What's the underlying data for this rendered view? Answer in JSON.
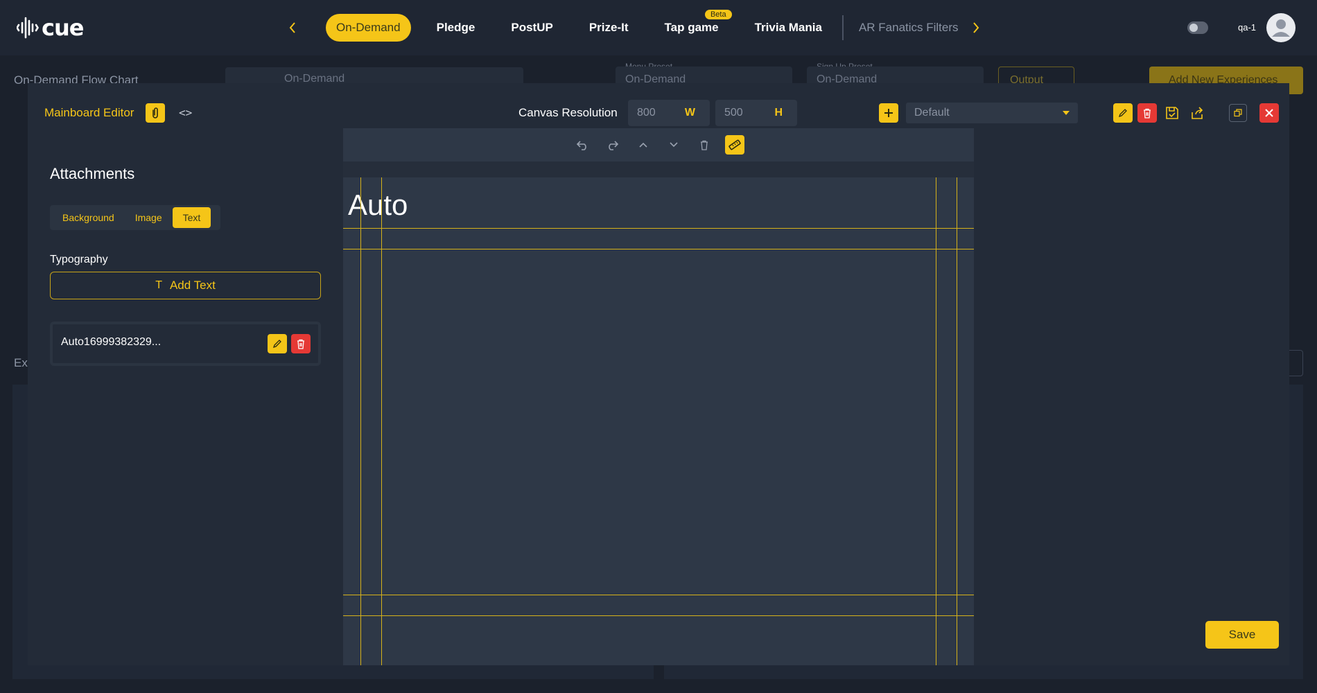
{
  "app": {
    "logo_text": "cue"
  },
  "nav": {
    "tabs": [
      {
        "label": "On-Demand",
        "state": "active"
      },
      {
        "label": "Pledge"
      },
      {
        "label": "PostUP"
      },
      {
        "label": "Prize-It"
      },
      {
        "label": "Tap game",
        "badge": "Beta"
      },
      {
        "label": "Trivia Mania"
      },
      {
        "label": "AR Fanatics Filters",
        "state": "dim"
      }
    ]
  },
  "user": {
    "name": "qa-1"
  },
  "background_page": {
    "title": "On-Demand Flow Chart",
    "flow_select_value": "On-Demand",
    "menu_preset_label": "Menu Preset",
    "menu_preset_value": "On-Demand",
    "signup_preset_label": "Sign Up Preset",
    "signup_preset_value": "On-Demand",
    "output_label": "Output",
    "add_experience_label": "Add New Experiences",
    "section_label": "Exp"
  },
  "modal": {
    "title": "Mainboard Editor",
    "canvas_resolution_label": "Canvas Resolution",
    "width_value": "800",
    "width_unit": "W",
    "height_value": "500",
    "height_unit": "H",
    "preset_value": "Default",
    "attachments_title": "Attachments",
    "attachment_tabs": [
      {
        "label": "Background"
      },
      {
        "label": "Image"
      },
      {
        "label": "Text",
        "state": "active"
      }
    ],
    "typography_label": "Typography",
    "add_text_label": "Add Text",
    "attachment_items": [
      {
        "name": "Auto16999382329..."
      }
    ],
    "canvas_text": "Auto",
    "save_label": "Save"
  },
  "colors": {
    "accent": "#f5c518",
    "danger": "#e53935",
    "background": "#1b212c",
    "panel": "#232b38",
    "canvas": "#2e3847"
  }
}
